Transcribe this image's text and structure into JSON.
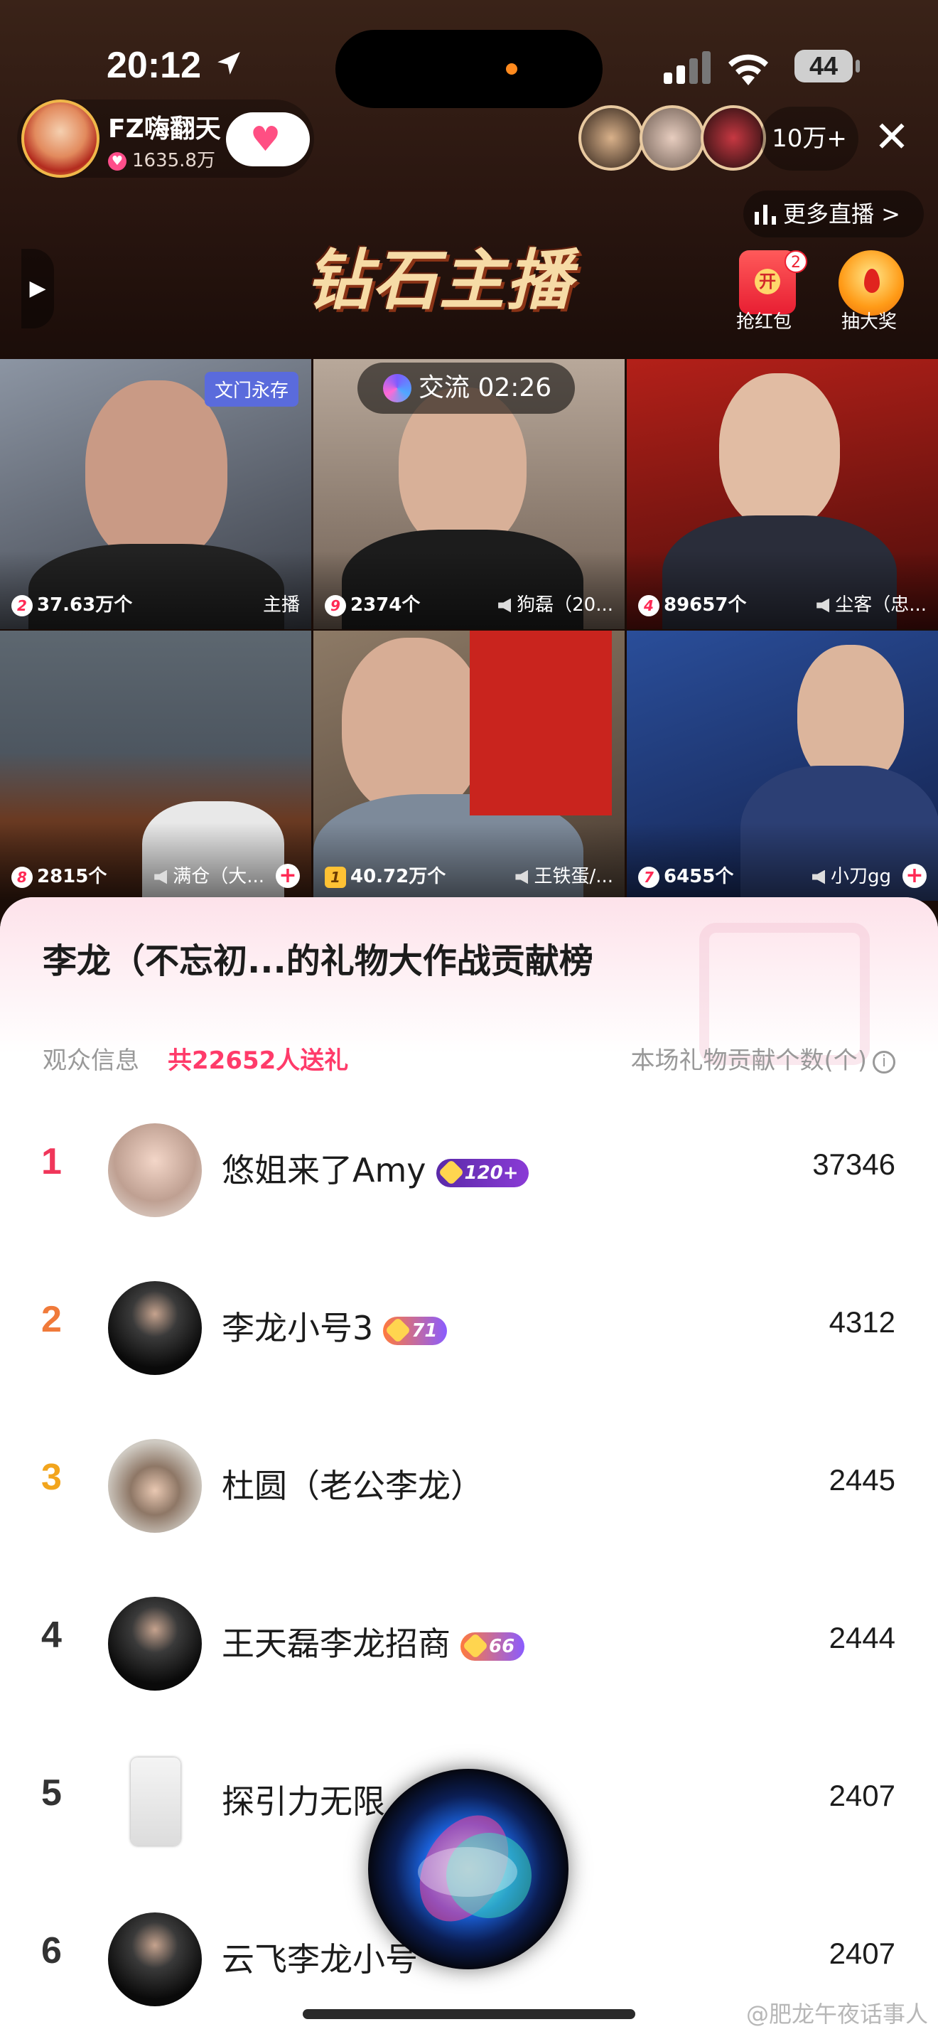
{
  "status": {
    "time": "20:12",
    "battery": "44"
  },
  "host": {
    "name": "FZ嗨翻天",
    "fans": "1635.8万",
    "follow_icon": "heart-plus-icon"
  },
  "viewers": {
    "count": "10万+"
  },
  "more_live": "更多直播 >",
  "banner": "钻石主播",
  "red_packet": {
    "label": "抢红包",
    "badge": "2",
    "open": "开"
  },
  "lottery": {
    "label": "抽大奖"
  },
  "timer": "交流 02:26",
  "grid": [
    {
      "rank": "2",
      "count": "37.63万个",
      "right": "主播",
      "tag": "文门永存"
    },
    {
      "rank": "9",
      "count": "2374个",
      "right": "狗磊（20..."
    },
    {
      "rank": "4",
      "count": "89657个",
      "right": "尘客（忠..."
    },
    {
      "rank": "8",
      "count": "2815个",
      "right": "满仓（大..."
    },
    {
      "rank": "1",
      "count": "40.72万个",
      "right": "王铁蛋/..."
    },
    {
      "rank": "7",
      "count": "6455个",
      "right": "小刀gg"
    }
  ],
  "sheet": {
    "title": "李龙（不忘初...的礼物大作战贡献榜",
    "audience_label": "观众信息",
    "audience_count": "共22652人送礼",
    "contrib_label": "本场礼物贡献个数(个)",
    "info_icon": "i"
  },
  "ranking": [
    {
      "rank": "1",
      "name": "悠姐来了Amy",
      "level": "120+",
      "value": "37346"
    },
    {
      "rank": "2",
      "name": "李龙小号3",
      "level": "71",
      "value": "4312"
    },
    {
      "rank": "3",
      "name": "杜圆（老公李龙）",
      "level": "",
      "value": "2445"
    },
    {
      "rank": "4",
      "name": "王天磊李龙招商",
      "level": "66",
      "value": "2444"
    },
    {
      "rank": "5",
      "name": "探引力无限",
      "level": "",
      "value": "2407"
    },
    {
      "rank": "6",
      "name": "云飞李龙小号",
      "level": "",
      "value": "2407"
    }
  ],
  "watermark": "@肥龙午夜话事人",
  "colors": {
    "accent_pink": "#ff3b6a",
    "rank1": "#f0365a",
    "rank2": "#f07a3a",
    "rank3": "#f2a51d"
  }
}
